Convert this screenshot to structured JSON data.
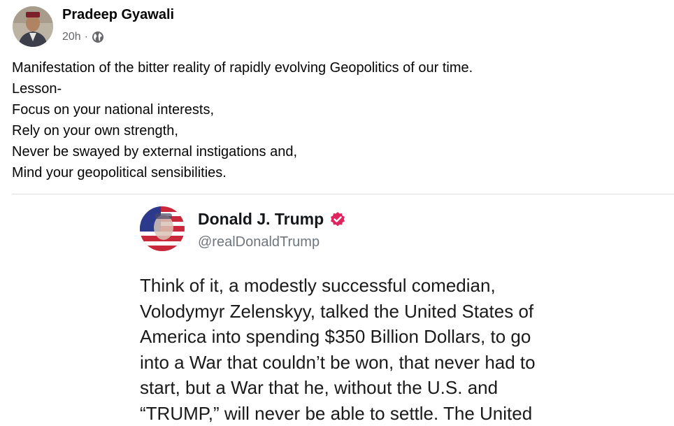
{
  "post": {
    "author": "Pradeep Gyawali",
    "timestamp": "20h",
    "separator": "·",
    "privacy_icon": "globe-icon",
    "text_lines": [
      "Manifestation of the bitter reality of rapidly evolving Geopolitics of our time.",
      "Lesson-",
      "Focus on your national interests,",
      "Rely on your own strength,",
      "Never be swayed by external instigations and,",
      "Mind your geopolitical sensibilities."
    ]
  },
  "tweet": {
    "name": "Donald J. Trump",
    "handle": "@realDonaldTrump",
    "verified_icon": "verified-badge-icon",
    "verified_color": "#e0245e",
    "text_lines": [
      "Think of it, a modestly successful comedian,",
      "Volodymyr Zelenskyy, talked the United States of",
      "America into spending $350 Billion Dollars, to go",
      "into a War that couldn’t be won, that never had to",
      "start, but a War that he, without the U.S. and",
      "“TRUMP,” will never be able to settle. The United"
    ]
  },
  "colors": {
    "text_primary": "#050505",
    "text_secondary": "#65676b",
    "divider": "#dadde1"
  }
}
